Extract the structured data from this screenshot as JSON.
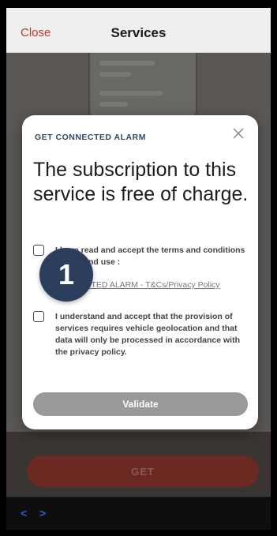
{
  "header": {
    "close_label": "Close",
    "title": "Services"
  },
  "modal": {
    "eyebrow": "GET CONNECTED ALARM",
    "heading": "The subscription to this service is free of charge.",
    "checkbox1": {
      "text": "I have read and accept the terms and conditions of sale and use :",
      "link_prefix": "CONNECTED ALARM - T&Cs/",
      "link_text": "Privacy Policy"
    },
    "checkbox2": {
      "text": "I understand and accept that the provision of services requires vehicle geolocation and that data will only be processed in accordance with the privacy policy."
    },
    "validate_label": "Validate"
  },
  "step_badge": "1",
  "footer": {
    "get_label": "GET",
    "nav_back": "<",
    "nav_forward": ">"
  },
  "icons": {
    "close": "close-icon"
  },
  "colors": {
    "accent_red": "#c0392b",
    "navy": "#2f4a66",
    "badge": "#2c3e5c"
  }
}
